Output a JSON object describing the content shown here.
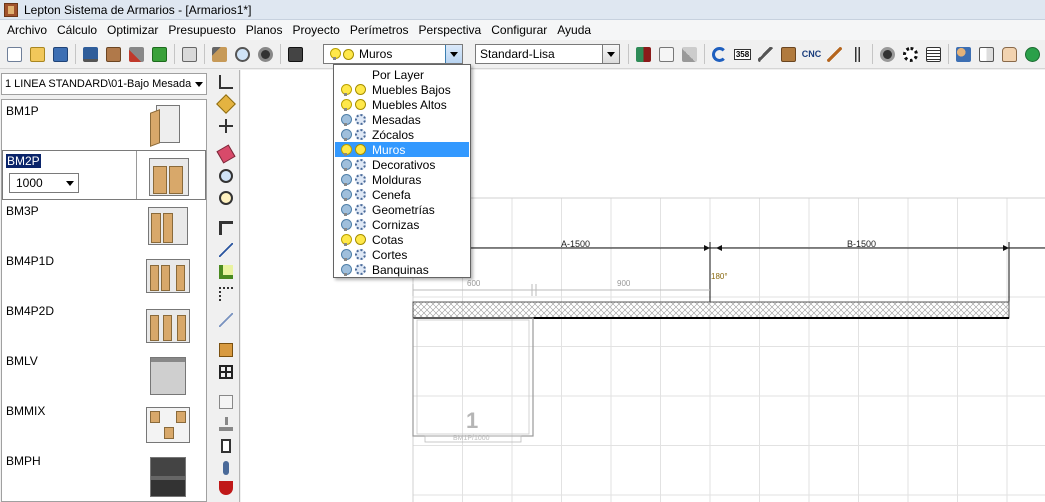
{
  "window": {
    "title": "Lepton Sistema de Armarios - [Armarios1*]"
  },
  "menu": [
    "Archivo",
    "Cálculo",
    "Optimizar",
    "Presupuesto",
    "Planos",
    "Proyecto",
    "Perímetros",
    "Perspectiva",
    "Configurar",
    "Ayuda"
  ],
  "toolbar": {
    "layer_select": {
      "value": "Muros"
    },
    "style_select": {
      "value": "Standard-Lisa"
    },
    "icon_labels": {
      "cnc": "CNC",
      "n358": "358"
    }
  },
  "layer_dropdown": {
    "items": [
      {
        "label": "Por Layer",
        "bulb": "none",
        "icon": "none"
      },
      {
        "label": "Muebles Bajos",
        "bulb": "on",
        "icon": "circle"
      },
      {
        "label": "Muebles Altos",
        "bulb": "on",
        "icon": "circle"
      },
      {
        "label": "Mesadas",
        "bulb": "off",
        "icon": "gear"
      },
      {
        "label": "Zócalos",
        "bulb": "off",
        "icon": "gear"
      },
      {
        "label": "Muros",
        "bulb": "on",
        "icon": "circle",
        "selected": true
      },
      {
        "label": "Decorativos",
        "bulb": "off",
        "icon": "gear"
      },
      {
        "label": "Molduras",
        "bulb": "off",
        "icon": "gear"
      },
      {
        "label": "Cenefa",
        "bulb": "off",
        "icon": "gear"
      },
      {
        "label": "Geometrías",
        "bulb": "off",
        "icon": "gear"
      },
      {
        "label": "Cornizas",
        "bulb": "off",
        "icon": "gear"
      },
      {
        "label": "Cotas",
        "bulb": "on",
        "icon": "circle"
      },
      {
        "label": "Cortes",
        "bulb": "off",
        "icon": "gear"
      },
      {
        "label": "Banquinas",
        "bulb": "off",
        "icon": "gear"
      }
    ]
  },
  "left_panel": {
    "category": "1 LINEA STANDARD\\01-Bajo Mesada",
    "items": [
      {
        "code": "BM1P"
      },
      {
        "code": "BM2P",
        "selected": true,
        "size": "1000"
      },
      {
        "code": "BM3P"
      },
      {
        "code": "BM4P1D"
      },
      {
        "code": "BM4P2D"
      },
      {
        "code": "BMLV"
      },
      {
        "code": "BMMIX"
      },
      {
        "code": "BMPH"
      }
    ]
  },
  "canvas": {
    "dim_a": "A-1500",
    "dim_b": "B-1500",
    "sub_dim_1": "600",
    "sub_dim_2": "900",
    "angle": "180°",
    "cabinet_number": "1",
    "cabinet_caption": "BM1P/1000"
  }
}
